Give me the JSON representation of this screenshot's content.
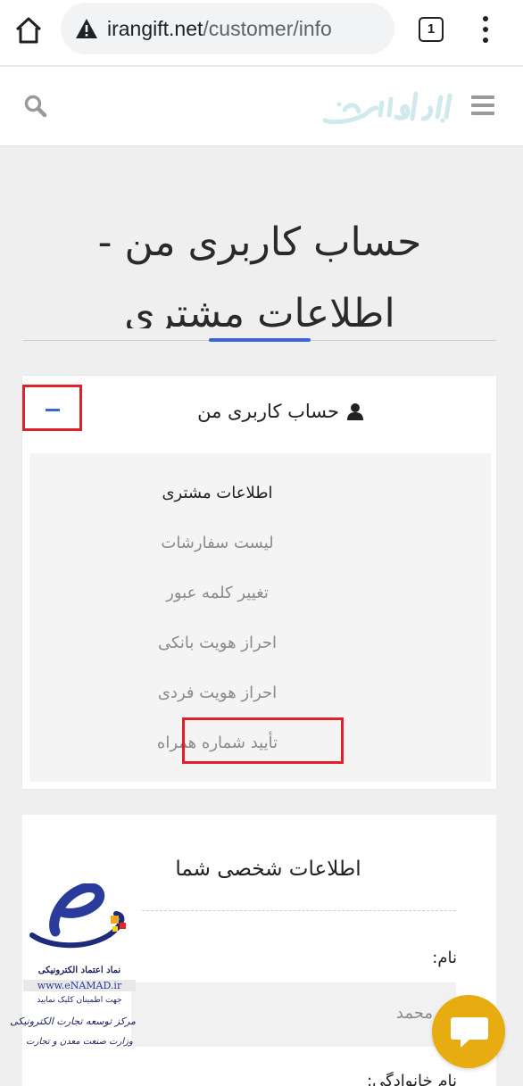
{
  "browser": {
    "url_domain": "irangift.net",
    "url_path": "/customer/info",
    "tab_count": "1",
    "icons": {
      "home": "home-icon",
      "warning": "warning-icon",
      "menu": "kebab-menu-icon"
    }
  },
  "header": {
    "logo_text": "ایران گیفت",
    "icons": {
      "search": "search-icon",
      "menu": "hamburger-icon"
    }
  },
  "page": {
    "title": "حساب کاربری من - اطلاعات مشتری"
  },
  "account_panel": {
    "title": "حساب کاربری من",
    "items": [
      {
        "label": "اطلاعات مشتری",
        "active": true
      },
      {
        "label": "لیست سفارشات",
        "active": false
      },
      {
        "label": "تغییر کلمه عبور",
        "active": false
      },
      {
        "label": "احراز هویت بانکی",
        "active": false
      },
      {
        "label": "احراز هویت فردی",
        "active": false
      },
      {
        "label": "تأیید شماره همراه",
        "active": false
      }
    ]
  },
  "personal_info": {
    "title": "اطلاعات شخصی شما",
    "first_name_label": "نام:",
    "first_name_value": "محمد",
    "last_name_label": "نام خانوادگی:"
  },
  "enamad": {
    "line1": "نماد اعتماد الکترونیکی",
    "line2": "www.eNAMAD.ir",
    "line3": "جهت اطمینان کلیک نمایید",
    "line4": "مرکز توسعه تجارت الکترونیکی",
    "line5": "وزارت صنعت معدن و تجارت"
  },
  "colors": {
    "accent": "#3a64d8",
    "highlight": "#e0202a",
    "chat": "#e6ac10",
    "logo": "#cfe9ec"
  }
}
